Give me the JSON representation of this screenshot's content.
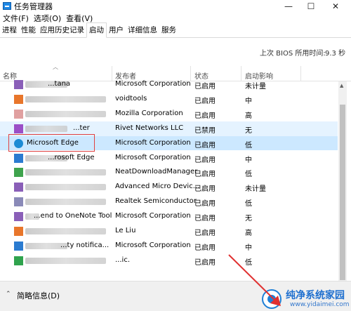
{
  "window": {
    "title": "任务管理器",
    "minimize": "—",
    "maximize": "☐",
    "close": "✕"
  },
  "menu": [
    "文件(F)",
    "选项(O)",
    "查看(V)"
  ],
  "tabs": [
    "进程",
    "性能",
    "应用历史记录",
    "启动",
    "用户",
    "详细信息",
    "服务"
  ],
  "active_tab": "启动",
  "bios": {
    "label": "上次 BIOS 所用时间:",
    "value": "9.3 秒"
  },
  "columns": {
    "name": "名称",
    "publisher": "发布者",
    "status": "状态",
    "impact": "启动影响"
  },
  "rows": [
    {
      "name": "...tana",
      "publisher": "Microsoft Corporation",
      "status": "已启用",
      "impact": "未计量",
      "icon_color": "#8a5fb8"
    },
    {
      "name": "",
      "publisher": "voidtools",
      "status": "已启用",
      "impact": "中",
      "icon_color": "#e8762b"
    },
    {
      "name": "",
      "publisher": "Mozilla Corporation",
      "status": "已启用",
      "impact": "高",
      "icon_color": "#e0a0a0"
    },
    {
      "name": "...ter",
      "publisher": "Rivet Networks LLC",
      "status": "已禁用",
      "impact": "无",
      "icon_color": "#9b4fc7"
    },
    {
      "name": "Microsoft Edge",
      "publisher": "Microsoft Corporation",
      "status": "已启用",
      "impact": "低",
      "icon_color": "#1b8bd4"
    },
    {
      "name": "...rosoft Edge",
      "publisher": "Microsoft Corporation",
      "status": "已启用",
      "impact": "中",
      "icon_color": "#2b7bd0"
    },
    {
      "name": "",
      "publisher": "NeatDownloadManager",
      "status": "已启用",
      "impact": "低",
      "icon_color": "#3fa34d"
    },
    {
      "name": "",
      "publisher": "Advanced Micro Devic...",
      "status": "已启用",
      "impact": "未计量",
      "icon_color": "#8a5fb8"
    },
    {
      "name": "",
      "publisher": "Realtek Semiconductor",
      "status": "已启用",
      "impact": "低",
      "icon_color": "#8a8ab8"
    },
    {
      "name": "...end to OneNote Tool",
      "publisher": "Microsoft Corporation",
      "status": "已启用",
      "impact": "无",
      "icon_color": "#8a5fb8"
    },
    {
      "name": "",
      "publisher": "Le Liu",
      "status": "已启用",
      "impact": "高",
      "icon_color": "#e8762b"
    },
    {
      "name": "...ty notifica...",
      "publisher": "Microsoft Corporation",
      "status": "已启用",
      "impact": "中",
      "icon_color": "#2b7bd0"
    },
    {
      "name": "",
      "publisher": "...ic.",
      "status": "已启用",
      "impact": "低",
      "icon_color": "#2fa34d"
    }
  ],
  "footer": {
    "label": "简略信息(D)",
    "chevron": "⌃"
  },
  "watermark": {
    "title": "纯净系统家园",
    "url": "www.yidaimei.com"
  }
}
